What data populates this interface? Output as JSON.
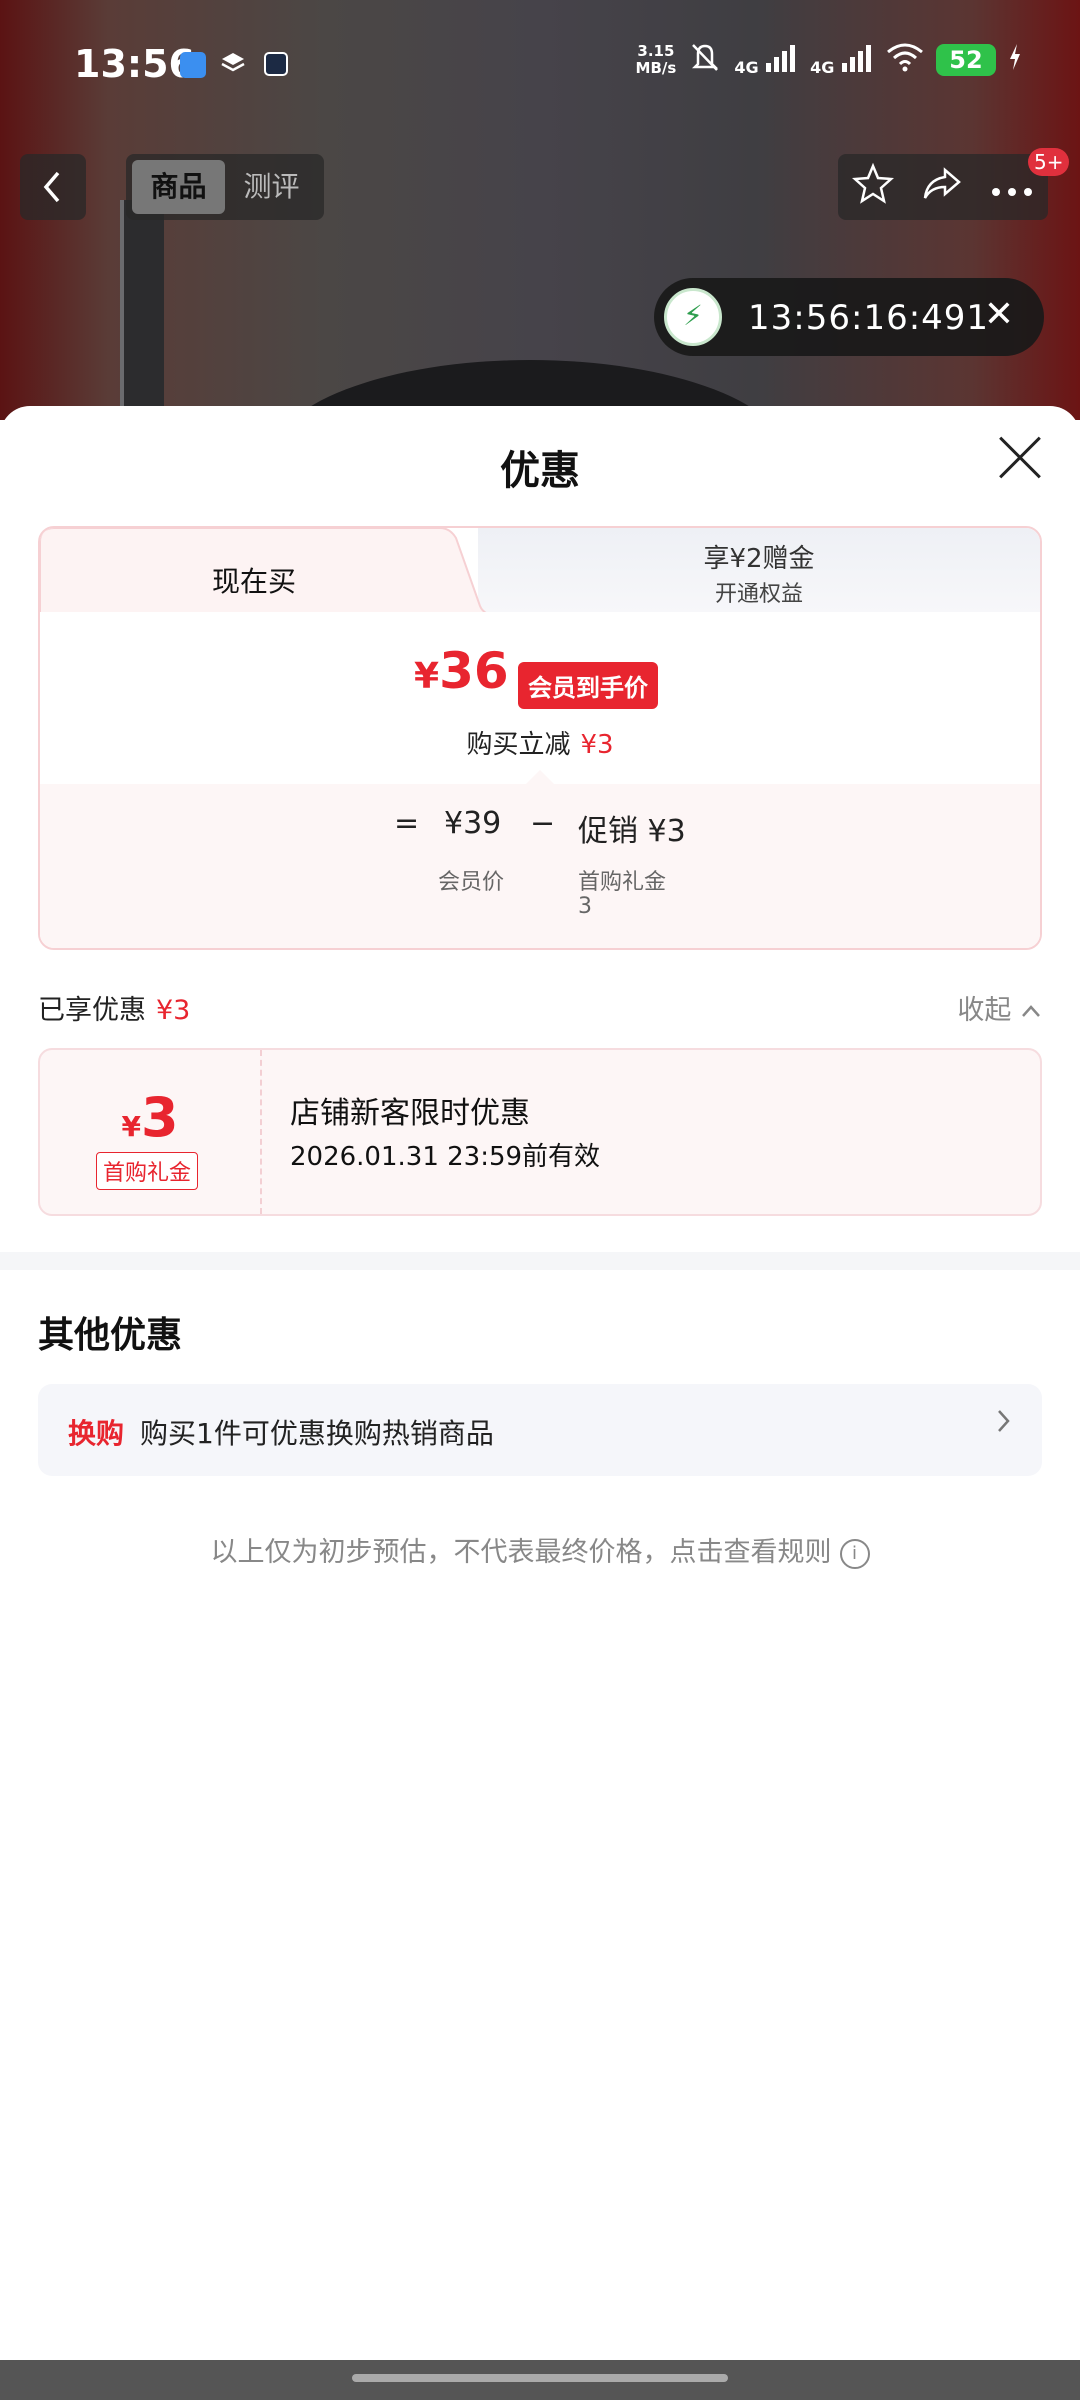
{
  "status_bar": {
    "time": "13:56",
    "speed_top": "3.15",
    "speed_bottom": "MB/s",
    "net1": "4G",
    "net2": "4G",
    "battery": "52"
  },
  "top_nav": {
    "tabs": [
      "商品",
      "测评"
    ],
    "badge": "5+"
  },
  "timer": {
    "text": "13:56:16:491",
    "close": "✕"
  },
  "sheet": {
    "title": "优惠",
    "price_card": {
      "tab_now": "现在买",
      "tab_bonus_line1": "享¥2赠金",
      "tab_bonus_line2": "开通权益",
      "currency": "¥",
      "final_price": "36",
      "member_tag": "会员到手价",
      "reduce_label": "购买立减",
      "reduce_value": "¥3",
      "formula": {
        "equals": "=",
        "member_price": "¥39",
        "member_price_label": "会员价",
        "minus": "−",
        "promo": "促销 ¥3",
        "promo_label": "首购礼金",
        "promo_sub": "3"
      }
    },
    "enjoyed": {
      "label": "已享优惠",
      "value": "¥3",
      "collapse": "收起"
    },
    "coupon": {
      "currency": "¥",
      "amount": "3",
      "tag": "首购礼金",
      "title": "店铺新客限时优惠",
      "expiry": "2026.01.31 23:59前有效"
    },
    "other": {
      "title": "其他优惠",
      "tag": "换购",
      "text": "购买1件可优惠换购热销商品"
    },
    "disclaimer": "以上仅为初步预估，不代表最终价格，点击查看规则"
  },
  "colors": {
    "accent_red": "#e8252f",
    "battery_green": "#2fc24a"
  }
}
